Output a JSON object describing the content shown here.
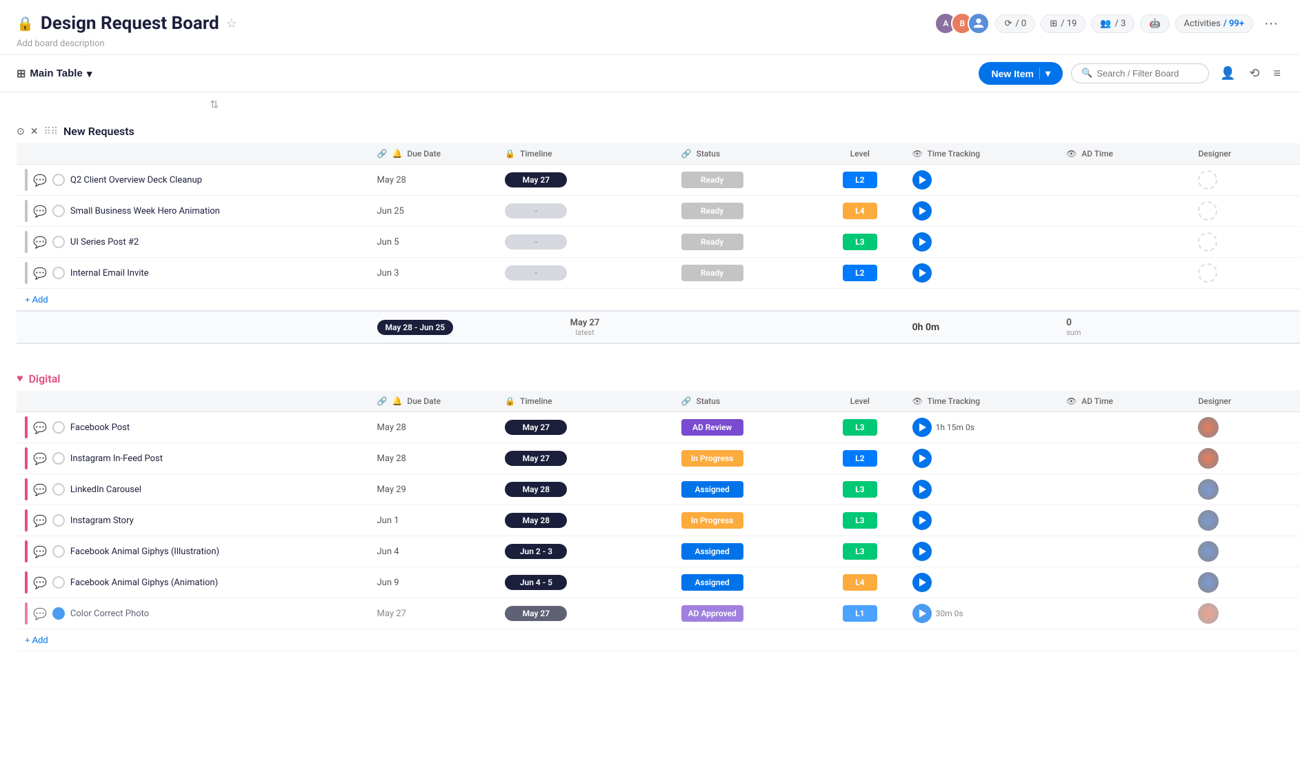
{
  "header": {
    "title": "Design Request Board",
    "description": "Add board description",
    "star_icon": "★",
    "lock_icon": "🔒"
  },
  "header_actions": {
    "automations_label": "/ 0",
    "integrations_label": "/ 19",
    "invite_label": "/ 3",
    "activities_label": "Activities",
    "activities_count": "/ 99+"
  },
  "toolbar": {
    "table_label": "Main Table",
    "new_item_label": "New Item",
    "search_placeholder": "Search / Filter Board"
  },
  "groups": [
    {
      "id": "new-requests",
      "label": "New Requests",
      "color": "#c4c4c4",
      "columns": {
        "due_date": "Due Date",
        "timeline": "Timeline",
        "status": "Status",
        "level": "Level",
        "time_tracking": "Time Tracking",
        "ad_time": "AD Time",
        "designer": "Designer"
      },
      "items": [
        {
          "name": "Q2 Client Overview Deck Cleanup",
          "due_date": "May 28",
          "timeline": "May 27",
          "timeline_type": "dark",
          "status": "Ready",
          "status_type": "ready",
          "level": "L2",
          "level_type": "l2",
          "time_tracking": "",
          "ad_time": "",
          "designer": null
        },
        {
          "name": "Small Business Week Hero Animation",
          "due_date": "Jun 25",
          "timeline": "-",
          "timeline_type": "empty",
          "status": "Ready",
          "status_type": "ready",
          "level": "L4",
          "level_type": "l4",
          "time_tracking": "",
          "ad_time": "",
          "designer": null
        },
        {
          "name": "UI Series Post #2",
          "due_date": "Jun 5",
          "timeline": "-",
          "timeline_type": "empty",
          "status": "Ready",
          "status_type": "ready",
          "level": "L3",
          "level_type": "l3",
          "time_tracking": "",
          "ad_time": "",
          "designer": null
        },
        {
          "name": "Internal Email Invite",
          "due_date": "Jun 3",
          "timeline": "-",
          "timeline_type": "empty",
          "status": "Ready",
          "status_type": "ready",
          "level": "L2",
          "level_type": "l2",
          "time_tracking": "",
          "ad_time": "",
          "designer": null
        }
      ],
      "summary": {
        "date_range": "May 28 - Jun 25",
        "latest_label": "May 27",
        "latest_sub": "latest",
        "time_tracking": "0h 0m",
        "ad_time_sum": "0",
        "ad_time_sub": "sum"
      }
    },
    {
      "id": "digital",
      "label": "Digital",
      "color": "#e44c7f",
      "columns": {
        "due_date": "Due Date",
        "timeline": "Timeline",
        "status": "Status",
        "level": "Level",
        "time_tracking": "Time Tracking",
        "ad_time": "AD Time",
        "designer": "Designer"
      },
      "items": [
        {
          "name": "Facebook Post",
          "due_date": "May 28",
          "timeline": "May 27",
          "timeline_type": "dark",
          "status": "AD Review",
          "status_type": "ad-review",
          "level": "L3",
          "level_type": "l3",
          "time_tracking": "1h 15m 0s",
          "ad_time": "",
          "designer": "F1",
          "designer_color": "#e87c5e"
        },
        {
          "name": "Instagram In-Feed Post",
          "due_date": "May 28",
          "timeline": "May 27",
          "timeline_type": "dark",
          "status": "In Progress",
          "status_type": "in-progress",
          "level": "L2",
          "level_type": "l2",
          "time_tracking": "",
          "ad_time": "",
          "designer": "F2",
          "designer_color": "#e87c5e"
        },
        {
          "name": "LinkedIn Carousel",
          "due_date": "May 29",
          "timeline": "May 28",
          "timeline_type": "dark",
          "status": "Assigned",
          "status_type": "assigned",
          "level": "L3",
          "level_type": "l3",
          "time_tracking": "",
          "ad_time": "",
          "designer": "M1",
          "designer_color": "#7b9bd6"
        },
        {
          "name": "Instagram Story",
          "due_date": "Jun 1",
          "timeline": "May 28",
          "timeline_type": "dark",
          "status": "In Progress",
          "status_type": "in-progress",
          "level": "L3",
          "level_type": "l3",
          "time_tracking": "",
          "ad_time": "",
          "designer": "M2",
          "designer_color": "#7b9bd6"
        },
        {
          "name": "Facebook Animal Giphys (Illustration)",
          "due_date": "Jun 4",
          "timeline": "Jun 2 - 3",
          "timeline_type": "dark",
          "status": "Assigned",
          "status_type": "assigned",
          "level": "L3",
          "level_type": "l3",
          "time_tracking": "",
          "ad_time": "",
          "designer": "M3",
          "designer_color": "#7b9bd6"
        },
        {
          "name": "Facebook Animal Giphys (Animation)",
          "due_date": "Jun 9",
          "timeline": "Jun 4 - 5",
          "timeline_type": "dark",
          "status": "Assigned",
          "status_type": "assigned",
          "level": "L4",
          "level_type": "l4",
          "time_tracking": "",
          "ad_time": "",
          "designer": "M4",
          "designer_color": "#7b9bd6"
        },
        {
          "name": "Color Correct Photo",
          "due_date": "May 27",
          "timeline": "May 27",
          "timeline_type": "dark",
          "status": "AD Approved",
          "status_type": "ad-review",
          "level": "L1",
          "level_type": "l2",
          "time_tracking": "30m 0s",
          "ad_time": "",
          "designer": "F3",
          "designer_color": "#e87c5e",
          "partial": true
        }
      ]
    }
  ],
  "add_label": "+ Add"
}
